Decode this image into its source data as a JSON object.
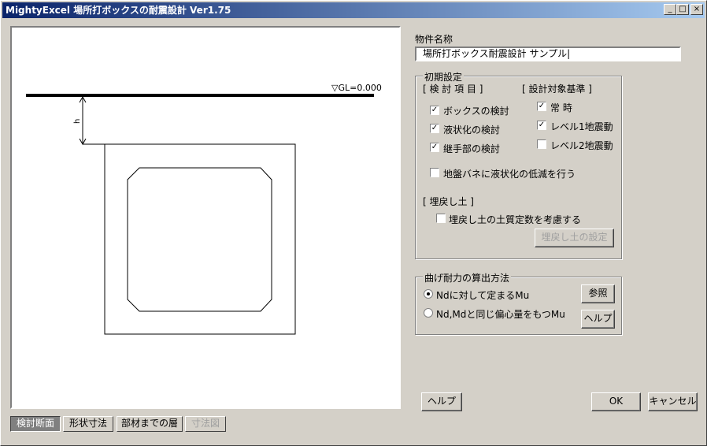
{
  "window": {
    "title": "MightyExcel 場所打ボックスの耐震設計  Ver1.75",
    "min": "_",
    "max": "□",
    "close": "×"
  },
  "drawing": {
    "gl_label": "▽GL=0.000",
    "h_label": "h"
  },
  "tabs": [
    {
      "label": "検討断面",
      "active": true
    },
    {
      "label": "形状寸法"
    },
    {
      "label": "部材までの層"
    },
    {
      "label": "寸法図",
      "disabled": true
    }
  ],
  "property_name": {
    "label": "物件名称",
    "value": "場所打ボックス耐震設計 サンプル|"
  },
  "initial": {
    "title": "初期設定",
    "check_items_header": "[ 検 討 項 目 ]",
    "standard_header": "[ 設計対象基準 ]",
    "items": [
      {
        "label": "ボックスの検討",
        "checked": "✓"
      },
      {
        "label": "液状化の検討",
        "checked": "✓"
      },
      {
        "label": "継手部の検討",
        "checked": "✓"
      }
    ],
    "standards": [
      {
        "label": "常  時",
        "checked": "✓"
      },
      {
        "label": "レベル1地震動",
        "checked": "✓"
      },
      {
        "label": "レベル2地震動",
        "checked": ""
      }
    ],
    "spring": {
      "label": "地盤バネに液状化の低減を行う",
      "checked": ""
    },
    "backfill_header": "[ 埋戻し土 ]",
    "backfill": {
      "label": "埋戻し土の土質定数を考慮する",
      "checked": ""
    },
    "backfill_button": "埋戻し土の設定"
  },
  "bending": {
    "title": "曲げ耐力の算出方法",
    "options": [
      {
        "label": "Ndに対して定まるMu",
        "selected": true
      },
      {
        "label": "Nd,Mdと同じ偏心量をもつMu",
        "selected": false
      }
    ],
    "ref_button": "参照",
    "help_button": "ヘルプ"
  },
  "footer": {
    "help": "ヘルプ",
    "ok": "OK",
    "cancel": "キャンセル"
  }
}
